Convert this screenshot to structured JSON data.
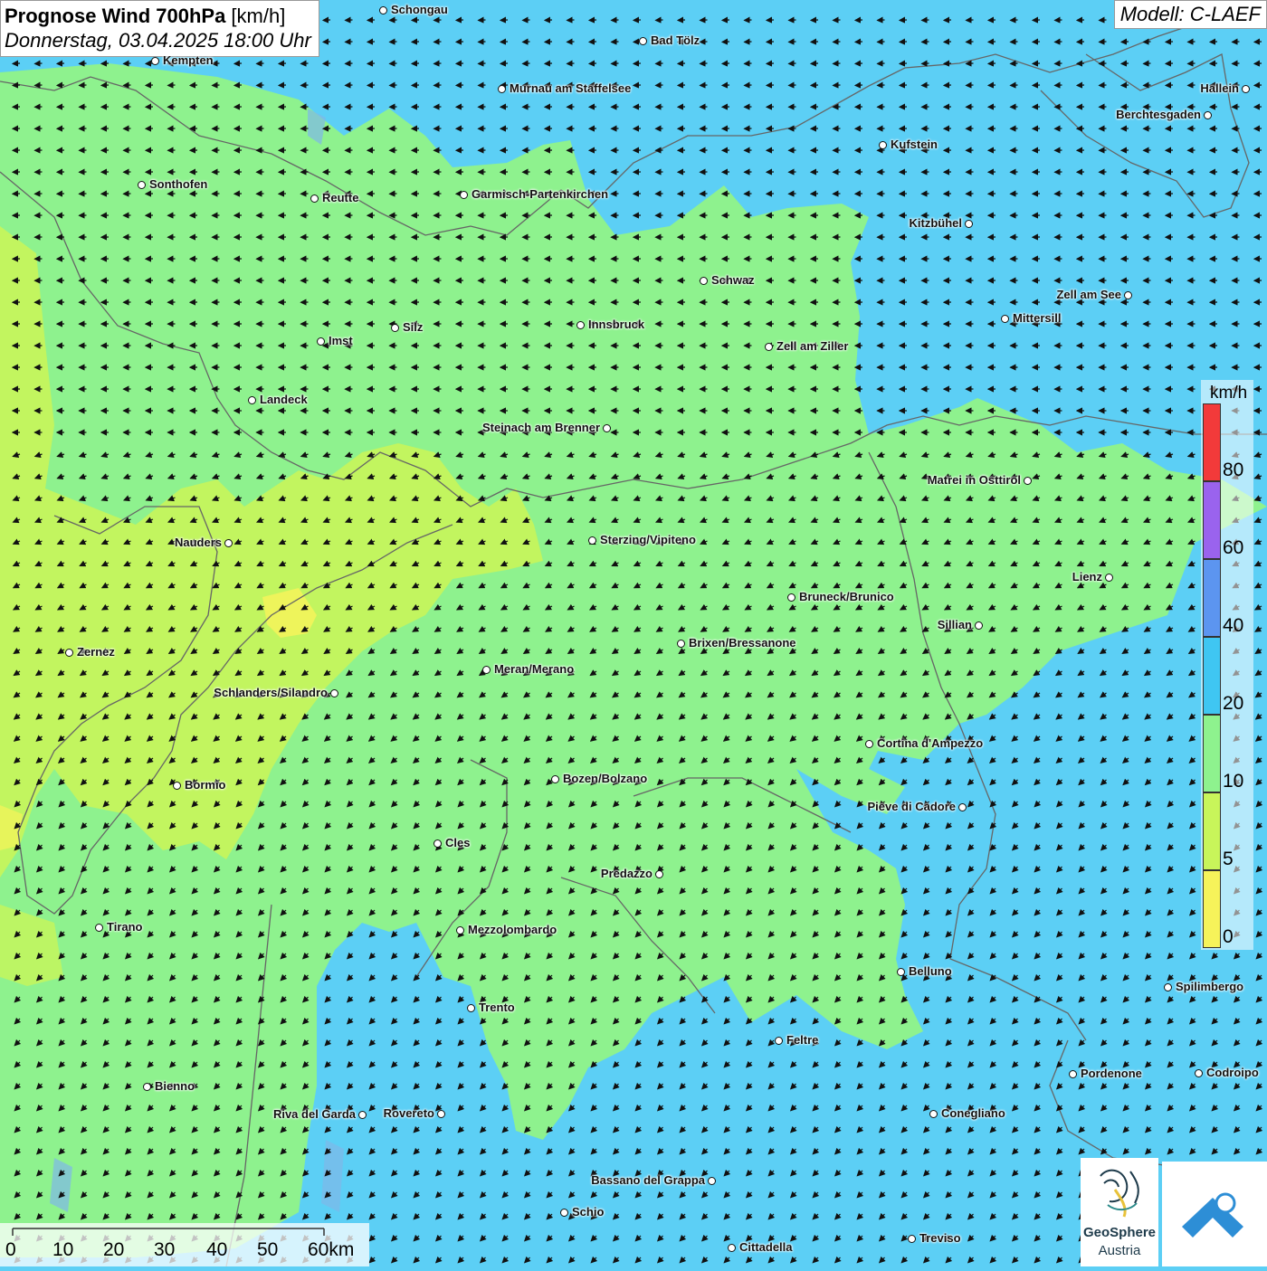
{
  "header": {
    "title_bold": "Prognose Wind 700hPa",
    "title_unit": " [km/h]",
    "datetime": "Donnerstag, 03.04.2025 18:00 Uhr",
    "model": "Modell: C-LAEF"
  },
  "legend": {
    "unit": "km/h",
    "classes": [
      {
        "label": "0",
        "color": "#f6f35a"
      },
      {
        "label": "5",
        "color": "#c8f55a"
      },
      {
        "label": "10",
        "color": "#8ef28e"
      },
      {
        "label": "20",
        "color": "#3fc6f2"
      },
      {
        "label": "40",
        "color": "#5c95f0"
      },
      {
        "label": "60",
        "color": "#9a63ee"
      },
      {
        "label": "80",
        "color": "#f23a3a"
      }
    ]
  },
  "scalebar": {
    "ticks": [
      "0",
      "10",
      "20",
      "30",
      "40",
      "50",
      "60km"
    ]
  },
  "cities": [
    "Schongau",
    "Bad Tölz",
    "Kempten",
    "Murnau am Staffelsee",
    "Hallein",
    "Berchtesgaden",
    "Kufstein",
    "Sonthofen",
    "Reutte",
    "Garmisch-Partenkirchen",
    "Kitzbühel",
    "Schwaz",
    "Zell am See",
    "Mittersill",
    "Silz",
    "Innsbruck",
    "Imst",
    "Zell am Ziller",
    "Landeck",
    "Steinach am Brenner",
    "Matrei in Osttirol",
    "Nauders",
    "Sterzing/Vipiteno",
    "Lienz",
    "Bruneck/Brunico",
    "Sillian",
    "Zernez",
    "Brixen/Bressanone",
    "Meran/Merano",
    "Schlanders/Silandro",
    "Cortina d'Ampezzo",
    "Bozen/Bolzano",
    "Bormio",
    "Pieve di Cadore",
    "Cles",
    "Predazzo",
    "Tirano",
    "Mezzolombardo",
    "Belluno",
    "Spilimbergo",
    "Trento",
    "Feltre",
    "Pordenone",
    "Codroipo",
    "Bienno",
    "Riva del Garda",
    "Rovereto",
    "Conegliano",
    "Bassano del Grappa",
    "Schio",
    "Treviso",
    "Cittadella"
  ],
  "logos": {
    "geosphere_line1": "GeoSphere",
    "geosphere_line2": "Austria"
  },
  "icons": [
    "geosphere-logo-icon",
    "cloud-chevron-logo-icon"
  ],
  "colors": {
    "wind_0_5": "#f6f35a",
    "wind_5_10": "#c8f55a",
    "wind_10_20": "#8ef28e",
    "wind_20_40": "#5ccff5"
  }
}
